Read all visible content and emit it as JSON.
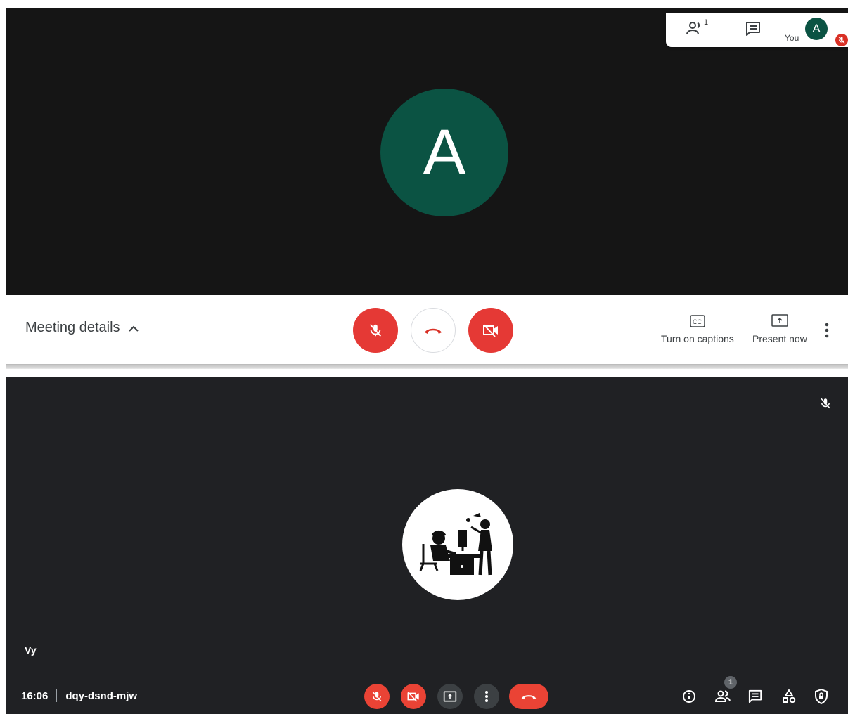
{
  "top_view": {
    "main_avatar_initial": "A",
    "top_right": {
      "people_count": "1",
      "you_label": "You",
      "avatar_initial": "A"
    },
    "toolbar": {
      "meeting_details_label": "Meeting details",
      "captions_label": "Turn on captions",
      "present_label": "Present now"
    }
  },
  "bottom_view": {
    "participant_name": "Vy",
    "time": "16:06",
    "meeting_code": "dqy-dsnd-mjw",
    "people_badge": "1"
  },
  "colors": {
    "avatar_green": "#0b5343",
    "danger_red": "#ea4335",
    "stage_dark": "#202124",
    "stage_black": "#151515"
  },
  "icons": [
    "people-icon",
    "chat-icon",
    "mic-off-icon",
    "hangup-icon",
    "camera-off-icon",
    "captions-icon",
    "present-icon",
    "more-vert-icon",
    "info-icon",
    "activities-icon",
    "host-controls-icon",
    "chevron-up-icon"
  ]
}
